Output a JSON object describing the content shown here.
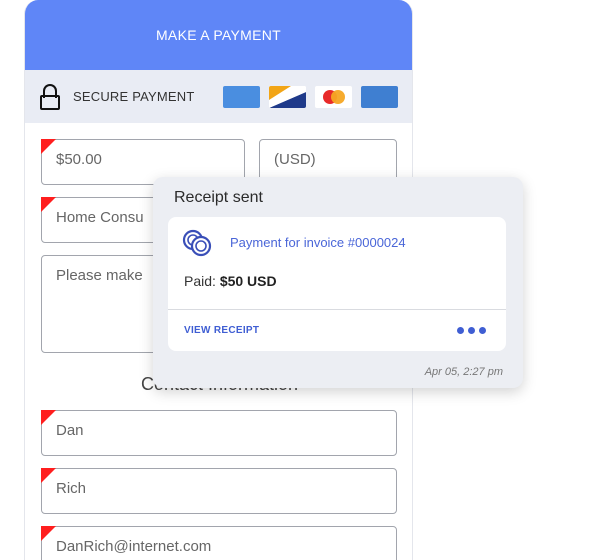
{
  "header": {
    "title": "MAKE A PAYMENT"
  },
  "secure_bar": {
    "label": "SECURE PAYMENT",
    "icons": [
      "lock-icon",
      "card-blue-icon",
      "card-amex-icon",
      "card-mastercard-icon",
      "card-generic-icon"
    ]
  },
  "form": {
    "amount": "$50.00",
    "currency": "(USD)",
    "description": "Home Consu",
    "notes": "Please make",
    "contact_title": "Contact Information",
    "first_name": "Dan",
    "last_name": "Rich",
    "email": "DanRich@internet.com"
  },
  "notification": {
    "title": "Receipt sent",
    "invoice": "Payment for invoice #0000024",
    "paid_label": "Paid:",
    "paid_value": "$50 USD",
    "action": "VIEW RECEIPT",
    "timestamp": "Apr 05, 2:27 pm"
  },
  "colors": {
    "header": "#5f86f7",
    "secure_bar": "#e9ecf4",
    "required_marker": "#ff1e1e",
    "link": "#3f5ed3"
  }
}
